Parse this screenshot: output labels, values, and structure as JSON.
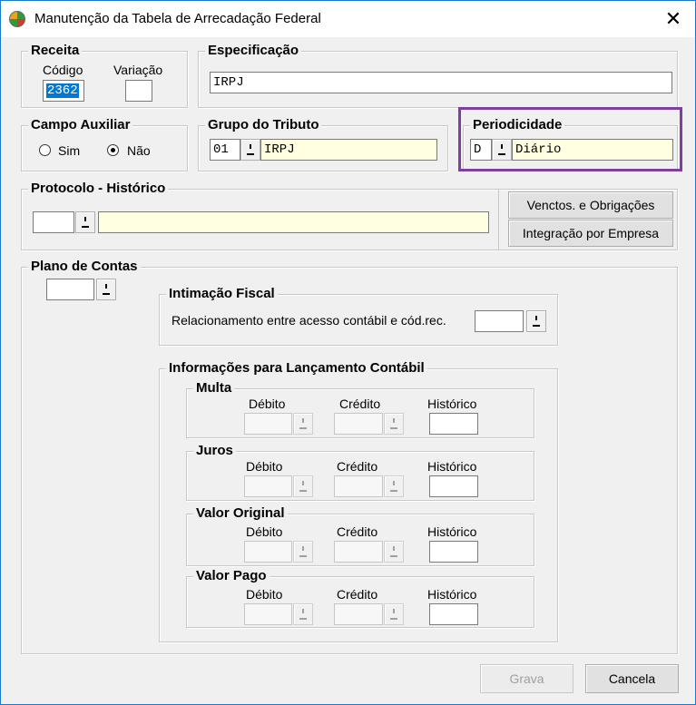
{
  "window": {
    "title": "Manutenção da Tabela de Arrecadação Federal",
    "close_glyph": "✕"
  },
  "receita": {
    "legend": "Receita",
    "codigo_label": "Código",
    "codigo_value": "2362",
    "variacao_label": "Variação",
    "variacao_value": ""
  },
  "especificacao": {
    "legend": "Especificação",
    "value": "IRPJ"
  },
  "campo_auxiliar": {
    "legend": "Campo Auxiliar",
    "options": [
      {
        "label": "Sim",
        "checked": false
      },
      {
        "label": "Não",
        "checked": true
      }
    ]
  },
  "grupo_tributo": {
    "legend": "Grupo do Tributo",
    "code": "01",
    "description": "IRPJ"
  },
  "periodicidade": {
    "legend": "Periodicidade",
    "code": "D",
    "description": "Diário",
    "highlight_color": "#7f3f9f"
  },
  "protocolo": {
    "legend": "Protocolo - Histórico",
    "code": "",
    "description": "",
    "btn_venctos": "Venctos. e Obrigações",
    "btn_integracao": "Integração por Empresa"
  },
  "plano_contas": {
    "legend": "Plano de Contas",
    "value": "",
    "intimacao": {
      "legend": "Intimação Fiscal",
      "label": "Relacionamento entre acesso contábil e cód.rec.",
      "value": ""
    },
    "lancamento": {
      "legend": "Informações para Lançamento Contábil",
      "groups": [
        {
          "legend": "Multa",
          "debito": "Débito",
          "credito": "Crédito",
          "historico": "Histórico"
        },
        {
          "legend": "Juros",
          "debito": "Débito",
          "credito": "Crédito",
          "historico": "Histórico"
        },
        {
          "legend": "Valor Original",
          "debito": "Débito",
          "credito": "Crédito",
          "historico": "Histórico"
        },
        {
          "legend": "Valor Pago",
          "debito": "Débito",
          "credito": "Crédito",
          "historico": "Histórico"
        }
      ]
    }
  },
  "footer": {
    "grava": "Grava",
    "cancela": "Cancela"
  },
  "colors": {
    "field_yellow": "#ffffe1",
    "selection": "#0078d7",
    "window_border": "#1979ca"
  }
}
